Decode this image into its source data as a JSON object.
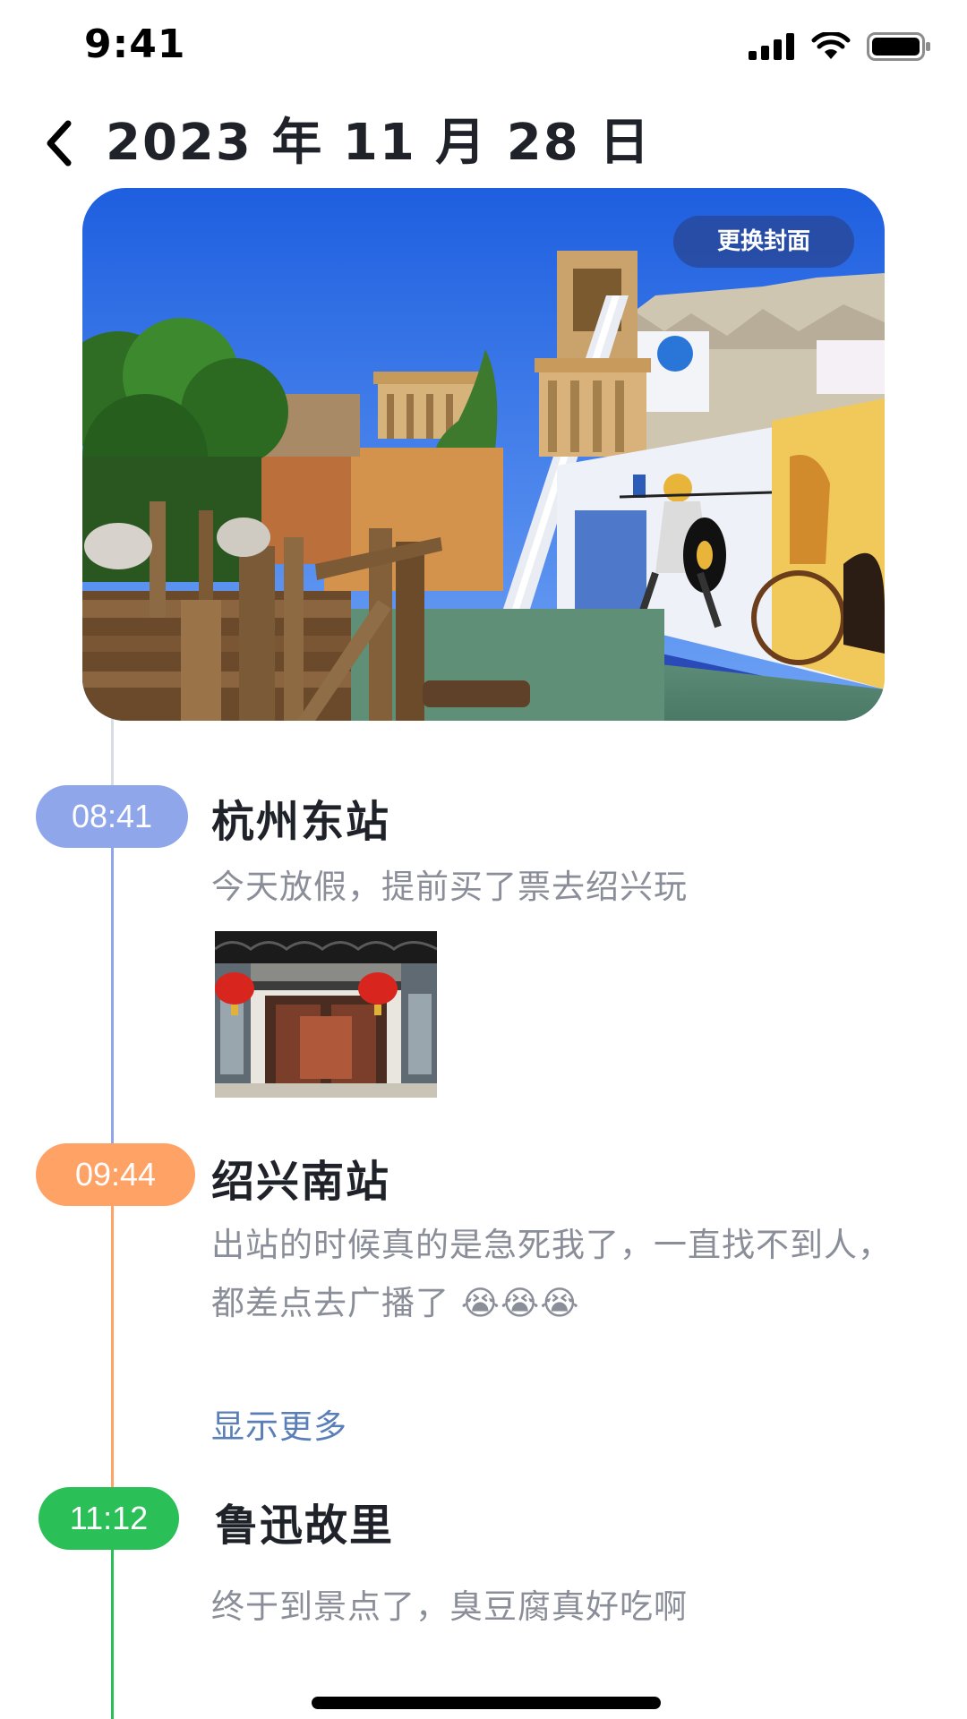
{
  "status_bar": {
    "time": "9:41"
  },
  "header": {
    "title": "2023 年 11 月 28 日"
  },
  "cover": {
    "change_cover_label": "更换封面"
  },
  "timeline": [
    {
      "time": "08:41",
      "title": "杭州东站",
      "text": "今天放假，提前买了票去绍兴玩",
      "color": "#8fa7ea"
    },
    {
      "time": "09:44",
      "title": "绍兴南站",
      "text": "出站的时候真的是急死我了，一直找不到人，都差点去广播了 😭😭😭",
      "show_more": "显示更多",
      "color": "#ffa266"
    },
    {
      "time": "11:12",
      "title": "鲁迅故里",
      "text": "终于到景点了，臭豆腐真好吃啊",
      "color": "#2bbf57"
    }
  ],
  "icons": [
    "cellular-signal-icon",
    "wifi-icon",
    "battery-icon",
    "back-chevron-icon"
  ]
}
